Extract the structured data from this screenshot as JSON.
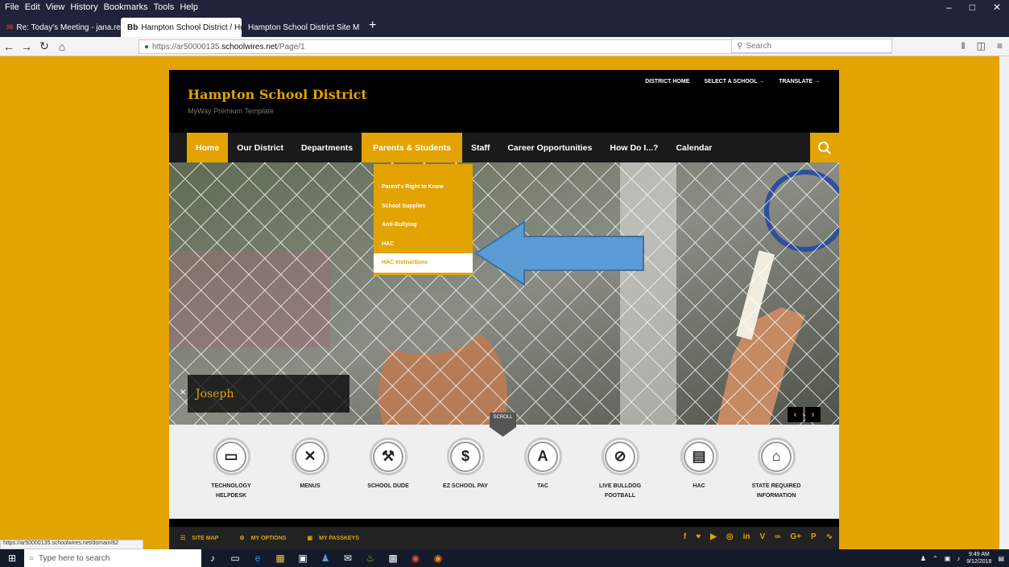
{
  "browser": {
    "menu": [
      "File",
      "Edit",
      "View",
      "History",
      "Bookmarks",
      "Tools",
      "Help"
    ],
    "tabs": [
      {
        "label": "Re: Today's Meeting - jana.rey"
      },
      {
        "label": "Hampton School District / Hor"
      },
      {
        "label": "Hampton School District Site M"
      }
    ],
    "url_prefix": "https://ar50000135.",
    "url_domain": "schoolwires.net",
    "url_path": "/Page/1",
    "search_placeholder": "Search",
    "status_url": "https://ar50000135.schoolwires.net/domain/62"
  },
  "site": {
    "title": "Hampton School District",
    "subtitle": "MyWay Premium Template",
    "top_links": [
      "DISTRICT HOME",
      "SELECT A SCHOOL →",
      "TRANSLATE →"
    ],
    "nav": [
      "Home",
      "Our District",
      "Departments",
      "Parents & Students",
      "Staff",
      "Career Opportunities",
      "How Do I...?",
      "Calendar"
    ],
    "dropdown": [
      "Parent's Right to Know",
      "School Supplies",
      "Anti-Bullying",
      "HAC",
      "HAC Instructions"
    ],
    "caption": "Joseph",
    "scroll_label": "SCROLL",
    "quick_links": [
      {
        "label": "TECHNOLOGY HELPDESK",
        "icon": "laptop-icon",
        "glyph": "▭"
      },
      {
        "label": "MENUS",
        "icon": "utensils-icon",
        "glyph": "✕"
      },
      {
        "label": "SCHOOL DUDE",
        "icon": "wrench-icon",
        "glyph": "⚒"
      },
      {
        "label": "EZ SCHOOL PAY",
        "icon": "dollar-icon",
        "glyph": "$"
      },
      {
        "label": "TAC",
        "icon": "pen-icon",
        "glyph": "A"
      },
      {
        "label": "LIVE BULLDOG FOOTBALL",
        "icon": "football-icon",
        "glyph": "⊘"
      },
      {
        "label": "HAC",
        "icon": "book-icon",
        "glyph": "▤"
      },
      {
        "label": "STATE REQUIRED INFORMATION",
        "icon": "home-icon",
        "glyph": "⌂"
      }
    ],
    "footer": [
      "SITE MAP",
      "MY OPTIONS",
      "MY PASSKEYS"
    ],
    "social": [
      "f",
      "♥",
      "▶",
      "◎",
      "in",
      "V",
      "∞",
      "G+",
      "P",
      "∿"
    ]
  },
  "taskbar": {
    "search_placeholder": "Type here to search",
    "time": "9:49 AM",
    "date": "9/12/2018"
  },
  "colors": {
    "accent": "#e3a300",
    "annotation_arrow": "#5b9bd5"
  }
}
